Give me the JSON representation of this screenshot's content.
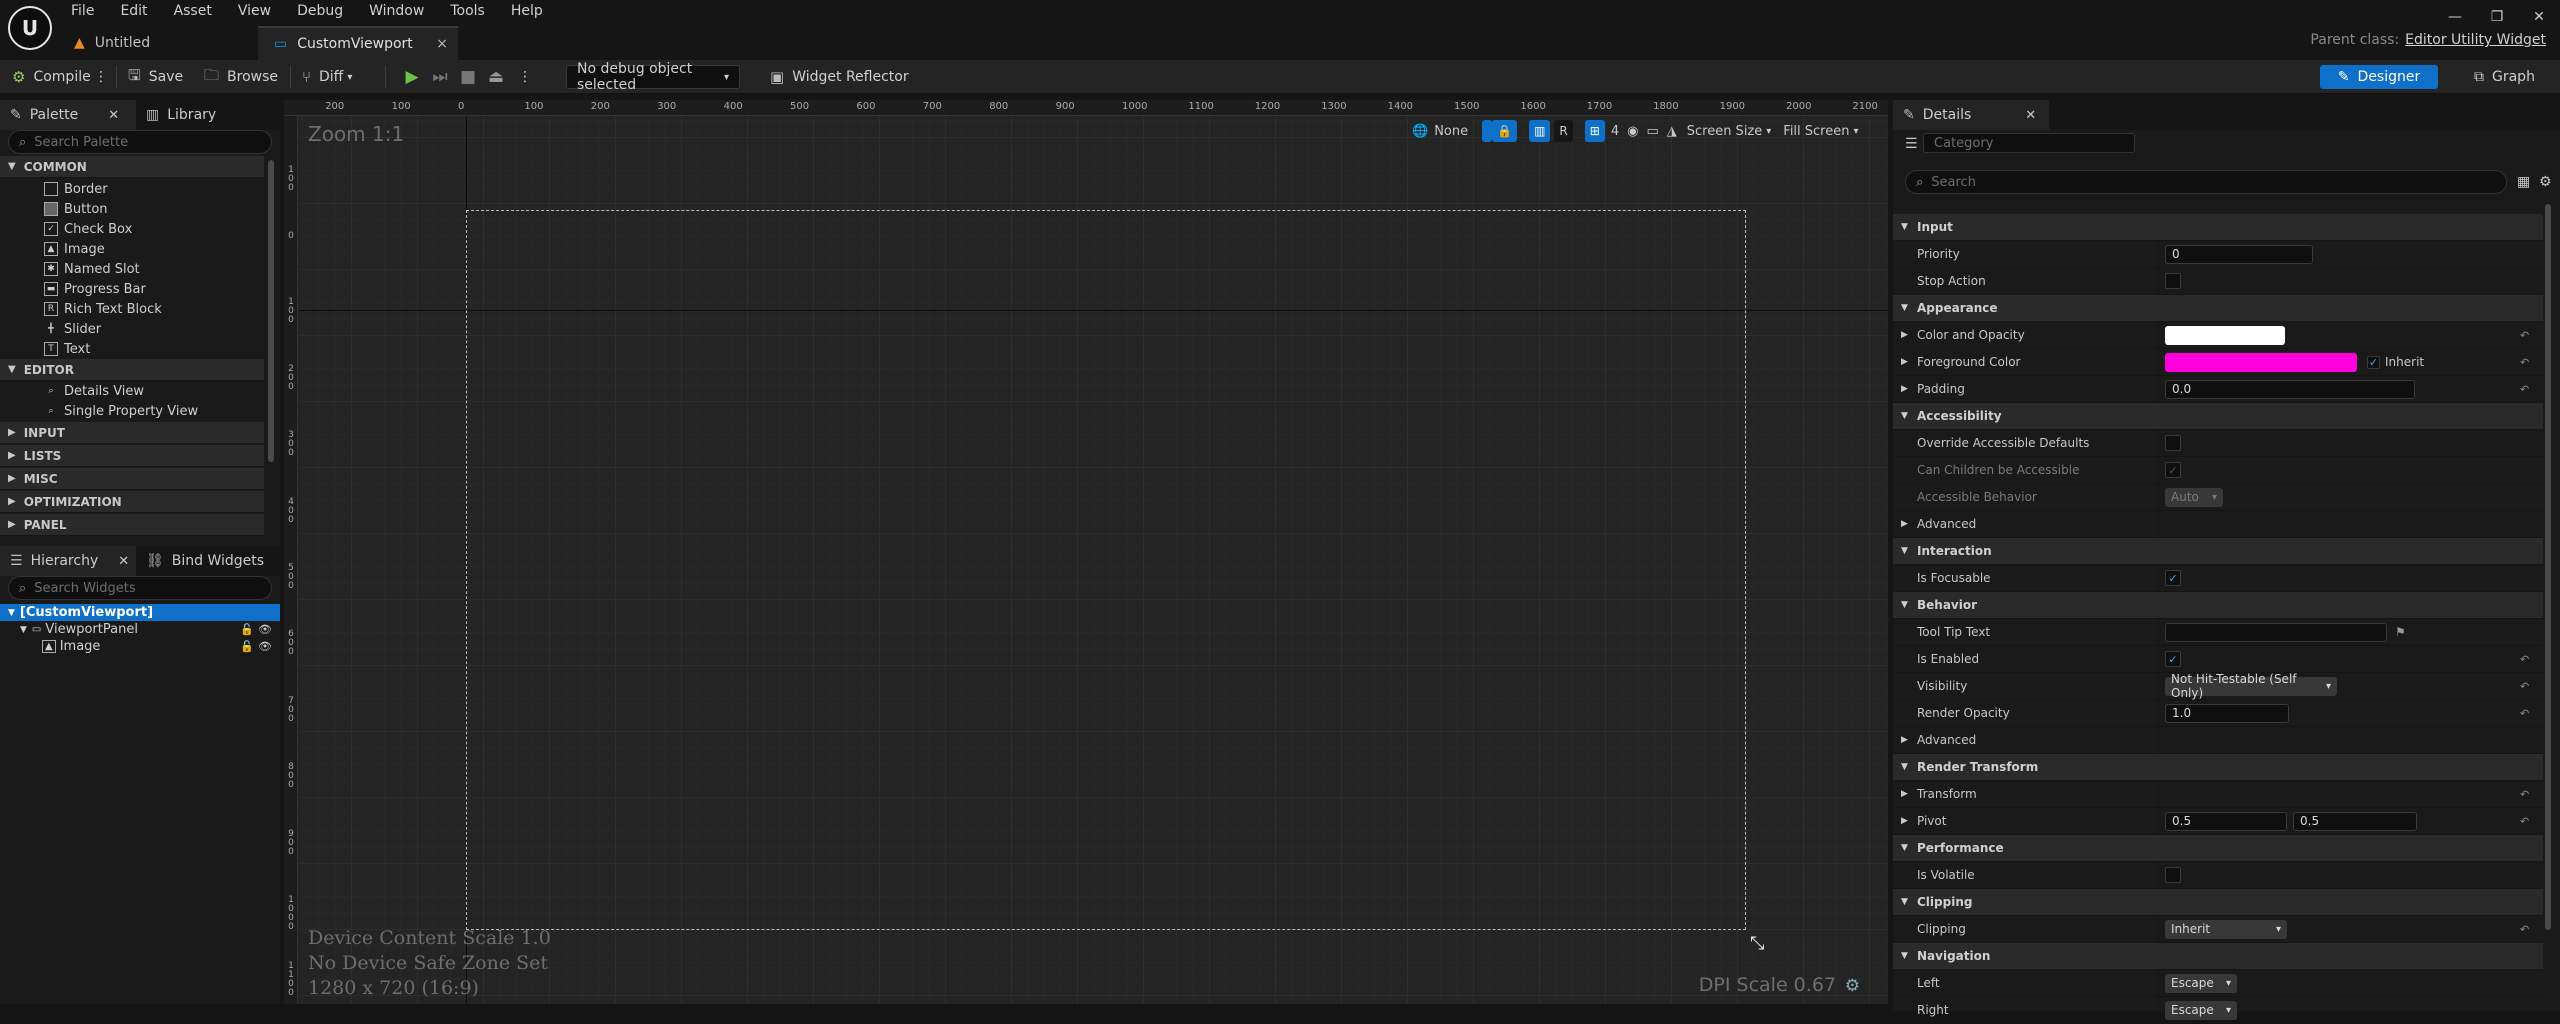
{
  "menu": [
    "File",
    "Edit",
    "Asset",
    "View",
    "Debug",
    "Window",
    "Tools",
    "Help"
  ],
  "tabs": [
    {
      "label": "Untitled",
      "close": ""
    },
    {
      "label": "CustomViewport",
      "close": "×"
    }
  ],
  "window": {
    "minimize": "—",
    "restore": "❐",
    "close": "✕"
  },
  "parent_class": {
    "label": "Parent class:",
    "value": "Editor Utility Widget"
  },
  "toolbar": {
    "compile": "Compile",
    "save": "Save",
    "browse": "Browse",
    "diff": "Diff",
    "debug_object": "No debug object selected",
    "widget_reflector": "Widget Reflector",
    "designer": "Designer",
    "graph": "Graph"
  },
  "palette": {
    "tab": "Palette",
    "library_tab": "Library",
    "search_placeholder": "Search Palette",
    "common": "COMMON",
    "common_items": [
      "Border",
      "Button",
      "Check Box",
      "Image",
      "Named Slot",
      "Progress Bar",
      "Rich Text Block",
      "Slider",
      "Text"
    ],
    "editor": "EDITOR",
    "editor_items": [
      "Details View",
      "Single Property View"
    ],
    "categories": [
      "INPUT",
      "LISTS",
      "MISC",
      "OPTIMIZATION",
      "PANEL"
    ]
  },
  "hierarchy": {
    "tab": "Hierarchy",
    "bind_tab": "Bind Widgets",
    "search_placeholder": "Search Widgets",
    "root": "[CustomViewport]",
    "panel": "ViewportPanel",
    "image": "Image"
  },
  "viewport": {
    "zoom": "Zoom 1:1",
    "device_scale": "Device Content Scale 1.0",
    "safe_zone": "No Device Safe Zone Set",
    "resolution": "1280 x 720 (16:9)",
    "dpi": "DPI Scale 0.67",
    "none_label": "None",
    "r_label": "R",
    "grid_num": "4",
    "screen_size": "Screen Size",
    "fill_screen": "Fill Screen",
    "ruler_top": [
      "200",
      "100",
      "0",
      "100",
      "200",
      "300",
      "400",
      "500",
      "600",
      "700",
      "800",
      "900",
      "1000",
      "1100",
      "1200",
      "1300",
      "1400",
      "1500",
      "1600",
      "1700",
      "1800",
      "1900",
      "2000",
      "2100"
    ],
    "ruler_left": [
      "100",
      "0",
      "100",
      "200",
      "300",
      "400",
      "500",
      "600",
      "700",
      "800",
      "900",
      "1000",
      "1100"
    ]
  },
  "details": {
    "tab": "Details",
    "category_placeholder": "Category",
    "search_placeholder": "Search",
    "input": "Input",
    "priority": "Priority",
    "priority_val": "0",
    "stop_action": "Stop Action",
    "appearance": "Appearance",
    "color_opacity": "Color and Opacity",
    "foreground": "Foreground Color",
    "inherit": "Inherit",
    "padding": "Padding",
    "padding_val": "0.0",
    "accessibility": "Accessibility",
    "override_acc": "Override Accessible Defaults",
    "children_acc": "Can Children be Accessible",
    "acc_behavior": "Accessible Behavior",
    "acc_behavior_val": "Auto",
    "advanced": "Advanced",
    "interaction": "Interaction",
    "focusable": "Is Focusable",
    "behavior": "Behavior",
    "tooltip": "Tool Tip Text",
    "enabled": "Is Enabled",
    "visibility": "Visibility",
    "visibility_val": "Not Hit-Testable (Self Only)",
    "render_opacity": "Render Opacity",
    "render_opacity_val": "1.0",
    "advanced2": "Advanced",
    "render_transform": "Render Transform",
    "transform": "Transform",
    "pivot": "Pivot",
    "pivot_x": "0.5",
    "pivot_y": "0.5",
    "performance": "Performance",
    "volatile": "Is Volatile",
    "clipping_cat": "Clipping",
    "clipping": "Clipping",
    "clipping_val": "Inherit",
    "navigation": "Navigation",
    "left": "Left",
    "left_val": "Escape",
    "right": "Right",
    "right_val": "Escape"
  },
  "colors": {
    "accent": "#0e70c8",
    "foreground_color": "#ff00dd",
    "color_opacity": "#ffffff"
  }
}
